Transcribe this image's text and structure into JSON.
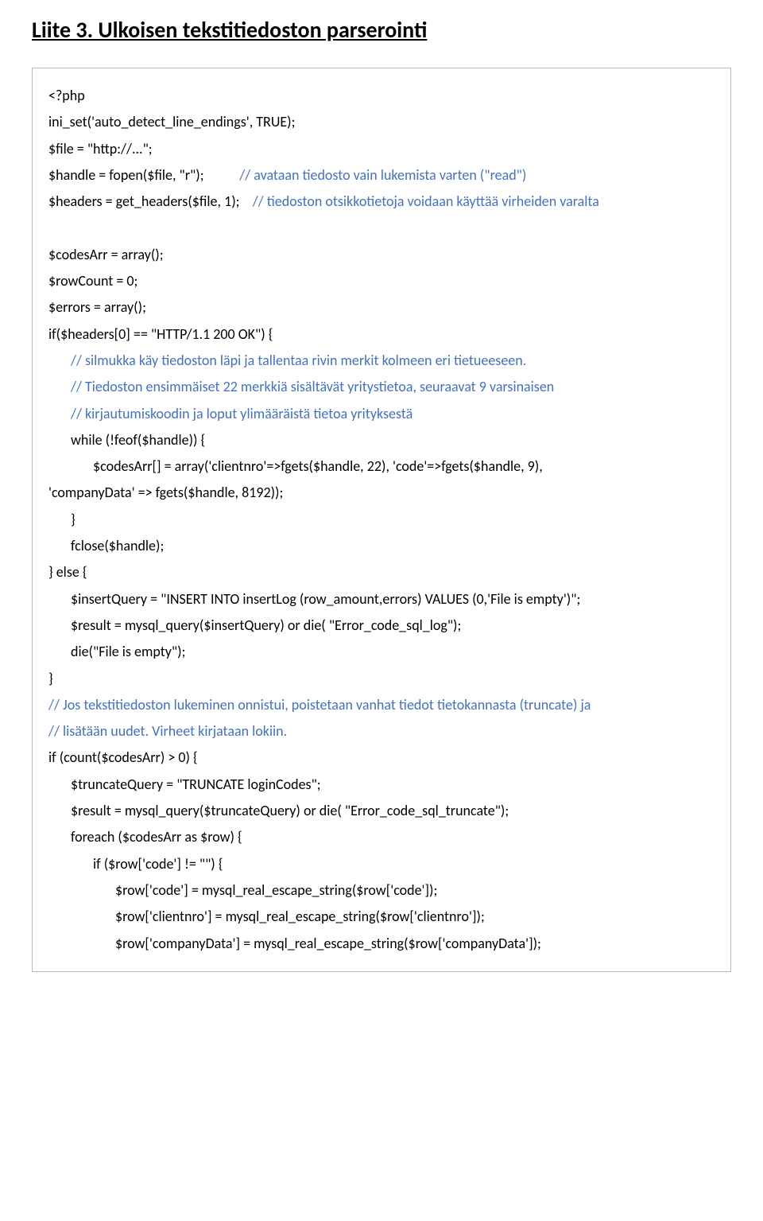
{
  "title": "Liite 3. Ulkoisen tekstitiedoston parserointi",
  "code": {
    "l1": "<?php",
    "l2": "ini_set('auto_detect_line_endings', TRUE);",
    "l3": "$file = \"http://...\";",
    "l4a": "$handle = fopen($file, \"r\");           ",
    "l4c": "// avataan tiedosto vain lukemista varten (\"read\")",
    "l5a": "$headers = get_headers($file, 1);    ",
    "l5c": "// tiedoston otsikkotietoja voidaan käyttää virheiden varalta",
    "l6": "$codesArr = array();",
    "l7": "$rowCount = 0;",
    "l8": "$errors = array();",
    "l9": "if($headers[0] == \"HTTP/1.1 200 OK\") {",
    "l10": "// silmukka käy tiedoston läpi ja tallentaa rivin merkit kolmeen eri tietueeseen.",
    "l11": "// Tiedoston ensimmäiset 22 merkkiä sisältävät yritystietoa, seuraavat 9 varsinaisen",
    "l12": "// kirjautumiskoodin ja loput ylimääräistä tietoa yrityksestä",
    "l13": "while (!feof($handle)) {",
    "l14": "$codesArr[] = array('clientnro'=>fgets($handle, 22), 'code'=>fgets($handle, 9),",
    "l14b": "'companyData' => fgets($handle, 8192));",
    "l15": "}",
    "l16": "fclose($handle);",
    "l17": "} else {",
    "l18": "$insertQuery = \"INSERT INTO insertLog (row_amount,errors) VALUES (0,'File is empty')\";",
    "l19": "$result = mysql_query($insertQuery) or die( \"Error_code_sql_log\");",
    "l20": "die(\"File is empty\");",
    "l21": "}",
    "l22": "// Jos tekstitiedoston lukeminen onnistui, poistetaan vanhat tiedot tietokannasta (truncate) ja",
    "l23": "// lisätään uudet. Virheet kirjataan lokiin.",
    "l24": "if (count($codesArr) > 0) {",
    "l25": "$truncateQuery = \"TRUNCATE loginCodes\";",
    "l26": "$result = mysql_query($truncateQuery) or die( \"Error_code_sql_truncate\");",
    "l27": "foreach ($codesArr as $row) {",
    "l28": "if ($row['code'] != \"\") {",
    "l29": "$row['code'] = mysql_real_escape_string($row['code']);",
    "l30": "$row['clientnro'] = mysql_real_escape_string($row['clientnro']);",
    "l31": "$row['companyData'] = mysql_real_escape_string($row['companyData']);"
  }
}
